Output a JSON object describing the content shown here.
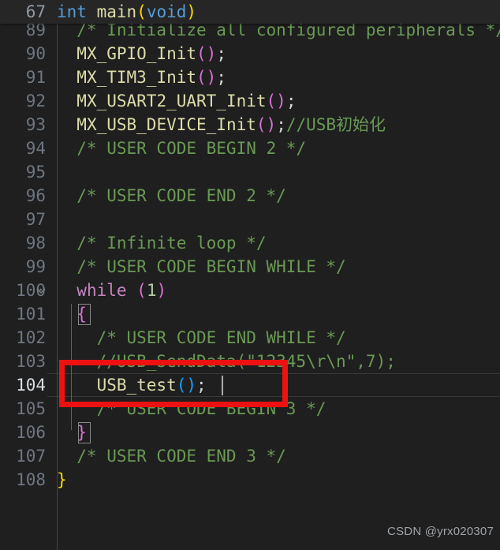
{
  "editor": {
    "watermark": "CSDN @yrx020307",
    "theme": {
      "background": "#1f1f1f",
      "sticky_background": "#262626",
      "line_number": "#6e7681",
      "line_number_active": "#d8dde3",
      "comment": "#6a9955",
      "keyword": "#569cd6",
      "control_keyword": "#c586c0",
      "function": "#dcdcaa",
      "number": "#b5cea8",
      "bracket_yellow": "#ffd700",
      "bracket_pink": "#da70d6",
      "bracket_blue": "#179fff",
      "annotation_red": "#ee1111",
      "cursor": "#aeafad"
    },
    "sticky": {
      "line_number": "67",
      "tokens": [
        {
          "text": "int",
          "cls": "t-key"
        },
        {
          "text": " ",
          "cls": "t-plain"
        },
        {
          "text": "main",
          "cls": "t-fn"
        },
        {
          "text": "(",
          "cls": "t-p-yellow"
        },
        {
          "text": "void",
          "cls": "t-key"
        },
        {
          "text": ")",
          "cls": "t-p-yellow"
        }
      ],
      "plain": "int main(void)"
    },
    "active_line": "104",
    "lines": [
      {
        "number": "89",
        "plain": "  /* Initialize all configured peripheral",
        "tokens": [
          {
            "text": "  /* Initialize all configured peripherals */",
            "cls": "t-comment"
          }
        ]
      },
      {
        "number": "90",
        "plain": "  MX_GPIO_Init();",
        "tokens": [
          {
            "text": "  ",
            "cls": "t-plain"
          },
          {
            "text": "MX_GPIO_Init",
            "cls": "t-fn"
          },
          {
            "text": "(",
            "cls": "t-p-pink"
          },
          {
            "text": ")",
            "cls": "t-p-pink"
          },
          {
            "text": ";",
            "cls": "t-semi"
          }
        ]
      },
      {
        "number": "91",
        "plain": "  MX_TIM3_Init();",
        "tokens": [
          {
            "text": "  ",
            "cls": "t-plain"
          },
          {
            "text": "MX_TIM3_Init",
            "cls": "t-fn"
          },
          {
            "text": "(",
            "cls": "t-p-pink"
          },
          {
            "text": ")",
            "cls": "t-p-pink"
          },
          {
            "text": ";",
            "cls": "t-semi"
          }
        ]
      },
      {
        "number": "92",
        "plain": "  MX_USART2_UART_Init();",
        "tokens": [
          {
            "text": "  ",
            "cls": "t-plain"
          },
          {
            "text": "MX_USART2_UART_Init",
            "cls": "t-fn"
          },
          {
            "text": "(",
            "cls": "t-p-pink"
          },
          {
            "text": ")",
            "cls": "t-p-pink"
          },
          {
            "text": ";",
            "cls": "t-semi"
          }
        ]
      },
      {
        "number": "93",
        "plain": "  MX_USB_DEVICE_Init();//USB初始化",
        "tokens": [
          {
            "text": "  ",
            "cls": "t-plain"
          },
          {
            "text": "MX_USB_DEVICE_Init",
            "cls": "t-fn"
          },
          {
            "text": "(",
            "cls": "t-p-pink"
          },
          {
            "text": ")",
            "cls": "t-p-pink"
          },
          {
            "text": ";",
            "cls": "t-semi"
          },
          {
            "text": "//USB",
            "cls": "t-comment"
          },
          {
            "text": "初始化",
            "cls": "t-comment t-cjk"
          }
        ]
      },
      {
        "number": "94",
        "plain": "  /* USER CODE BEGIN 2 */",
        "tokens": [
          {
            "text": "  /* USER CODE BEGIN 2 */",
            "cls": "t-comment"
          }
        ]
      },
      {
        "number": "95",
        "plain": "",
        "tokens": []
      },
      {
        "number": "96",
        "plain": "  /* USER CODE END 2 */",
        "tokens": [
          {
            "text": "  /* USER CODE END 2 */",
            "cls": "t-comment"
          }
        ]
      },
      {
        "number": "97",
        "plain": "",
        "tokens": []
      },
      {
        "number": "98",
        "plain": "  /* Infinite loop */",
        "tokens": [
          {
            "text": "  /* Infinite loop */",
            "cls": "t-comment"
          }
        ]
      },
      {
        "number": "99",
        "plain": "  /* USER CODE BEGIN WHILE */",
        "tokens": [
          {
            "text": "  /* USER CODE BEGIN WHILE */",
            "cls": "t-comment"
          }
        ]
      },
      {
        "number": "100",
        "plain": "  while (1)",
        "tokens": [
          {
            "text": "  ",
            "cls": "t-plain"
          },
          {
            "text": "while",
            "cls": "t-ctrl"
          },
          {
            "text": " ",
            "cls": "t-plain"
          },
          {
            "text": "(",
            "cls": "t-p-pink"
          },
          {
            "text": "1",
            "cls": "t-num"
          },
          {
            "text": ")",
            "cls": "t-p-pink"
          }
        ]
      },
      {
        "number": "101",
        "plain": "  {",
        "tokens": [
          {
            "text": "  ",
            "cls": "t-plain"
          },
          {
            "text": "{",
            "cls": "t-p-pink"
          }
        ]
      },
      {
        "number": "102",
        "plain": "    /* USER CODE END WHILE */",
        "tokens": [
          {
            "text": "    /* USER CODE END WHILE */",
            "cls": "t-comment"
          }
        ]
      },
      {
        "number": "103",
        "plain": "    //USB_SendData(\"12345\\r\\n\",7);",
        "tokens": [
          {
            "text": "    //USB_SendData(\"12345\\r\\n\",7);",
            "cls": "t-comment"
          }
        ]
      },
      {
        "number": "104",
        "plain": "    USB_test();",
        "tokens": [
          {
            "text": "    ",
            "cls": "t-plain"
          },
          {
            "text": "USB_test",
            "cls": "t-fn"
          },
          {
            "text": "(",
            "cls": "t-p-blue"
          },
          {
            "text": ")",
            "cls": "t-p-blue"
          },
          {
            "text": ";",
            "cls": "t-semi"
          }
        ]
      },
      {
        "number": "105",
        "plain": "    /* USER CODE BEGIN 3 */",
        "tokens": [
          {
            "text": "    /* USER CODE BEGIN 3 */",
            "cls": "t-comment"
          }
        ]
      },
      {
        "number": "106",
        "plain": "  }",
        "tokens": [
          {
            "text": "  ",
            "cls": "t-plain"
          },
          {
            "text": "}",
            "cls": "t-p-pink"
          }
        ]
      },
      {
        "number": "107",
        "plain": "  /* USER CODE END 3 */",
        "tokens": [
          {
            "text": "  /* USER CODE END 3 */",
            "cls": "t-comment"
          }
        ]
      },
      {
        "number": "108",
        "plain": "}",
        "tokens": [
          {
            "text": "}",
            "cls": "t-p-yellow"
          }
        ]
      }
    ]
  }
}
